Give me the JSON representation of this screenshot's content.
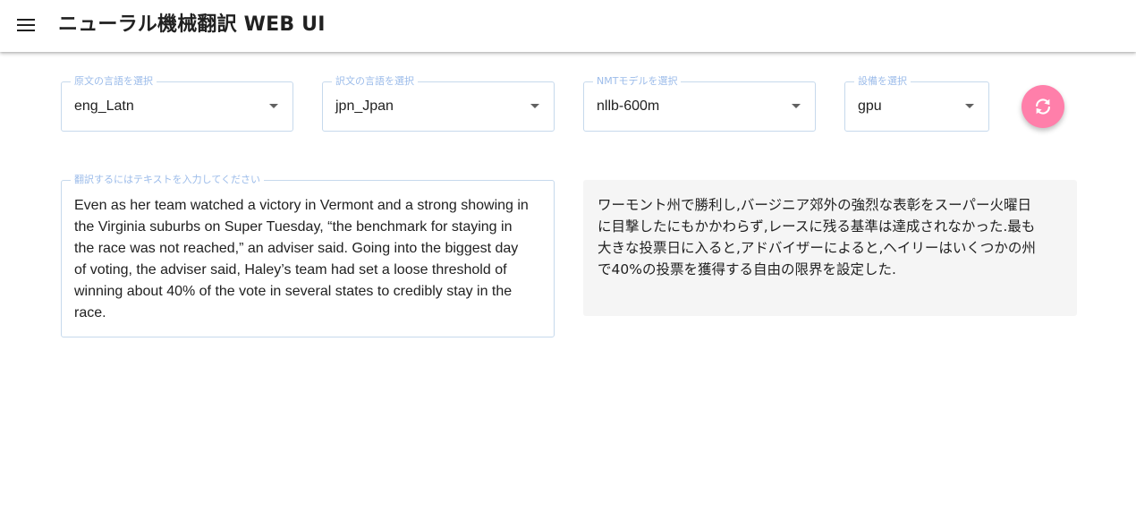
{
  "app": {
    "title": "ニューラル機械翻訳 WEB UI",
    "menu_icon": "hamburger-menu-icon"
  },
  "selectors": {
    "source_lang": {
      "label": "原文の言語を選択",
      "value": "eng_Latn"
    },
    "target_lang": {
      "label": "訳文の言語を選択",
      "value": "jpn_Jpan"
    },
    "model": {
      "label": "NMTモデルを選択",
      "value": "nllb-600m"
    },
    "device": {
      "label": "設備を選択",
      "value": "gpu"
    }
  },
  "swap_button": {
    "icon": "swap-refresh-icon",
    "color": "#ff7faa"
  },
  "input": {
    "label": "翻訳するにはテキストを入力してください",
    "lines": [
      "Even as her team watched a victory in Vermont and a strong showing in",
      "the Virginia suburbs on Super Tuesday, “the benchmark for staying in",
      "the race was not reached,” an adviser said. Going into the biggest day",
      "of voting, the adviser said, Haley’s team had set a loose threshold of",
      "winning about 40% of the vote in several states to credibly stay in the",
      "race."
    ]
  },
  "output": {
    "lines": [
      "ワーモント州で勝利し,バージニア郊外の強烈な表彰をスーパー火曜日",
      "に目撃したにもかかわらず,レースに残る基準は達成されなかった.最も",
      "大きな投票日に入ると,アドバイザーによると,ヘイリーはいくつかの州",
      "で40%の投票を獲得する自由の限界を設定した."
    ]
  },
  "colors": {
    "legend": "#9cbcea",
    "border": "#c6d9ec",
    "output_bg": "#f5f5f5"
  }
}
